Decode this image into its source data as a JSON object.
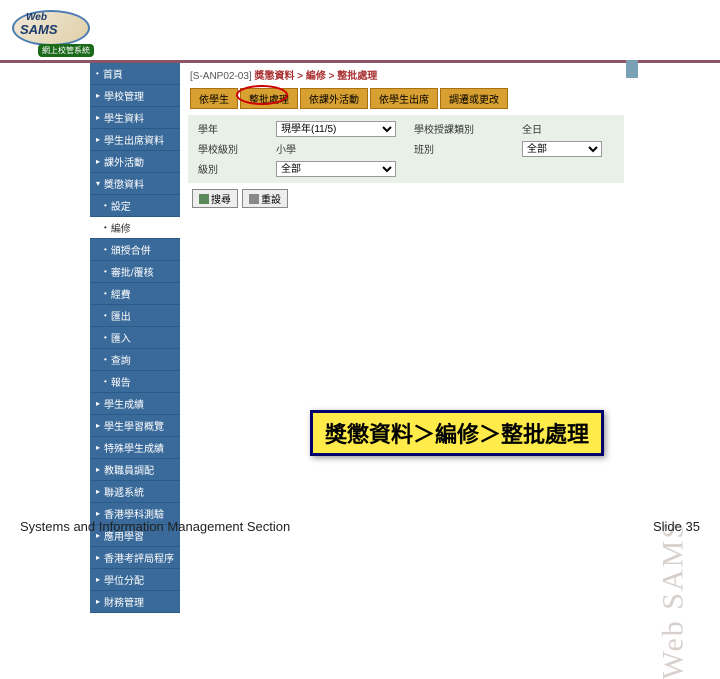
{
  "logo": {
    "web": "Web",
    "sams": "SAMS",
    "sub": "網上校管系統"
  },
  "sidebar": {
    "items": [
      {
        "label": "首頁",
        "type": "top"
      },
      {
        "label": "學校管理",
        "type": "cat"
      },
      {
        "label": "學生資料",
        "type": "cat"
      },
      {
        "label": "學生出席資料",
        "type": "cat"
      },
      {
        "label": "課外活動",
        "type": "cat"
      },
      {
        "label": "獎懲資料",
        "type": "cat",
        "expanded": true
      },
      {
        "label": "設定",
        "type": "sub"
      },
      {
        "label": "編修",
        "type": "sub",
        "selected": true
      },
      {
        "label": "頒授合併",
        "type": "sub"
      },
      {
        "label": "審批/覆核",
        "type": "sub"
      },
      {
        "label": "經費",
        "type": "sub"
      },
      {
        "label": "匯出",
        "type": "sub"
      },
      {
        "label": "匯入",
        "type": "sub"
      },
      {
        "label": "查詢",
        "type": "sub"
      },
      {
        "label": "報告",
        "type": "sub"
      },
      {
        "label": "學生成績",
        "type": "cat"
      },
      {
        "label": "學生學習概覽",
        "type": "cat"
      },
      {
        "label": "特殊學生成績",
        "type": "cat"
      },
      {
        "label": "教職員調配",
        "type": "cat"
      },
      {
        "label": "聯遞系統",
        "type": "cat"
      },
      {
        "label": "香港學科測驗",
        "type": "cat"
      },
      {
        "label": "應用學習",
        "type": "cat"
      },
      {
        "label": "香港考評局程序",
        "type": "cat"
      },
      {
        "label": "學位分配",
        "type": "cat"
      },
      {
        "label": "財務管理",
        "type": "cat"
      }
    ]
  },
  "breadcrumb": {
    "code": "[S-ANP02-03]",
    "path": "獎懲資料 > 編修 > 整批處理"
  },
  "tabs": [
    {
      "label": "依學生"
    },
    {
      "label": "整批處理",
      "circled": true
    },
    {
      "label": "依課外活動"
    },
    {
      "label": "依學生出席"
    },
    {
      "label": "調遷或更改"
    }
  ],
  "form": {
    "fields": {
      "year_label": "學年",
      "year_value": "現學年(11/5)",
      "class_type_label": "學校授課類別",
      "class_type_value": "全日",
      "level_label": "學校級別",
      "level_value": "小學",
      "class_label": "班別",
      "class_value": "全部",
      "group_label": "級別",
      "group_value": "全部"
    },
    "buttons": {
      "search": "搜尋",
      "reset": "重設"
    }
  },
  "callout": "獎懲資料＞編修＞整批處理",
  "watermark": "Web SAMS",
  "footer": {
    "left": "Systems and Information Management Section",
    "right_label": "Slide",
    "right_num": "35"
  }
}
